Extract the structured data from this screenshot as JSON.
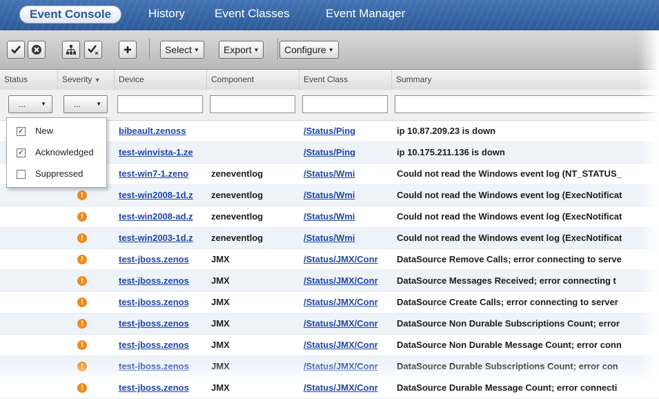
{
  "nav": {
    "tabs": [
      "Event Console",
      "History",
      "Event Classes",
      "Event Manager"
    ],
    "active": "Event Console"
  },
  "toolbar": {
    "icon_buttons": [
      "acknowledge-icon",
      "close-event-icon",
      "reclassify-icon",
      "select-all-icon",
      "add-icon"
    ],
    "menus": [
      "Select",
      "Export",
      "Configure"
    ]
  },
  "columns": [
    "Status",
    "Severity",
    "Device",
    "Component",
    "Event Class",
    "Summary"
  ],
  "filters": {
    "status_value": "...",
    "severity_value": "..."
  },
  "status_dropdown": [
    {
      "label": "New",
      "checked": true
    },
    {
      "label": "Acknowledged",
      "checked": true
    },
    {
      "label": "Suppressed",
      "checked": false
    }
  ],
  "events": [
    {
      "device": "bibeault.zenoss",
      "component": "",
      "event_class": "/Status/Ping",
      "summary": "ip 10.87.209.23 is down"
    },
    {
      "device": "test-winvista-1.ze",
      "component": "",
      "event_class": "/Status/Ping",
      "summary": "ip 10.175.211.136 is down"
    },
    {
      "device": "test-win7-1.zeno",
      "component": "zeneventlog",
      "event_class": "/Status/Wmi",
      "summary": "Could not read the Windows event log (NT_STATUS_"
    },
    {
      "device": "test-win2008-1d.z",
      "component": "zeneventlog",
      "event_class": "/Status/Wmi",
      "summary": "Could not read the Windows event log (ExecNotificat"
    },
    {
      "device": "test-win2008-ad.z",
      "component": "zeneventlog",
      "event_class": "/Status/Wmi",
      "summary": "Could not read the Windows event log (ExecNotificat"
    },
    {
      "device": "test-win2003-1d.z",
      "component": "zeneventlog",
      "event_class": "/Status/Wmi",
      "summary": "Could not read the Windows event log (ExecNotificat"
    },
    {
      "device": "test-jboss.zenos",
      "component": "JMX",
      "event_class": "/Status/JMX/Conr",
      "summary": "DataSource Remove Calls; error connecting to serve"
    },
    {
      "device": "test-jboss.zenos",
      "component": "JMX",
      "event_class": "/Status/JMX/Conr",
      "summary": "DataSource Messages Received; error connecting t"
    },
    {
      "device": "test-jboss.zenos",
      "component": "JMX",
      "event_class": "/Status/JMX/Conr",
      "summary": "DataSource Create Calls; error connecting to server"
    },
    {
      "device": "test-jboss.zenos",
      "component": "JMX",
      "event_class": "/Status/JMX/Conr",
      "summary": "DataSource Non Durable Subscriptions Count; error"
    },
    {
      "device": "test-jboss.zenos",
      "component": "JMX",
      "event_class": "/Status/JMX/Conr",
      "summary": "DataSource Non Durable Message Count; error conn"
    },
    {
      "device": "test-jboss.zenos",
      "component": "JMX",
      "event_class": "/Status/JMX/Conr",
      "summary": "DataSource Durable Subscriptions Count; error con"
    },
    {
      "device": "test-jboss.zenos",
      "component": "JMX",
      "event_class": "/Status/JMX/Conr",
      "summary": "DataSource Durable Message Count; error connecti"
    }
  ],
  "severity_glyph": "!",
  "colors": {
    "nav_bg": "#2f5d9b",
    "link": "#2146a8",
    "severity_error": "#f08a1c",
    "alt_row": "#eef3fa"
  }
}
